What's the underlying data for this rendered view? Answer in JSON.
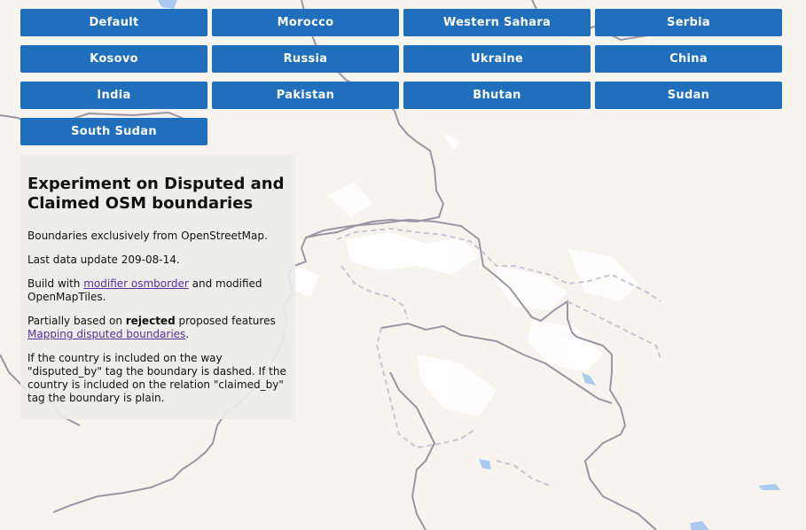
{
  "buttons": [
    "Default",
    "Morocco",
    "Western Sahara",
    "Serbia",
    "Kosovo",
    "Russia",
    "Ukraine",
    "China",
    "India",
    "Pakistan",
    "Bhutan",
    "Sudan",
    "South Sudan"
  ],
  "info": {
    "title": "Experiment on Disputed and Claimed OSM boundaries",
    "line1": "Boundaries exclusively from OpenStreetMap.",
    "line2": "Last data update 209-08-14.",
    "build_prefix": "Build with ",
    "build_link": "modifier osmborder",
    "build_suffix": " and modified OpenMapTiles.",
    "partial_prefix": "Partially based on ",
    "partial_bold": "rejected",
    "partial_mid": " proposed features ",
    "partial_link": "Mapping disputed boundaries",
    "partial_suffix": ".",
    "note": "If the country is included on the way \"disputed_by\" tag the boundary is dashed. If the country is included on the relation \"claimed_by\" tag the boundary is plain."
  },
  "colors": {
    "button": "#1f6fbd",
    "land": "#f7f4ef",
    "water": "#a9c9f0",
    "border": "#9a95a3",
    "disputed": "#c9c3d6"
  }
}
